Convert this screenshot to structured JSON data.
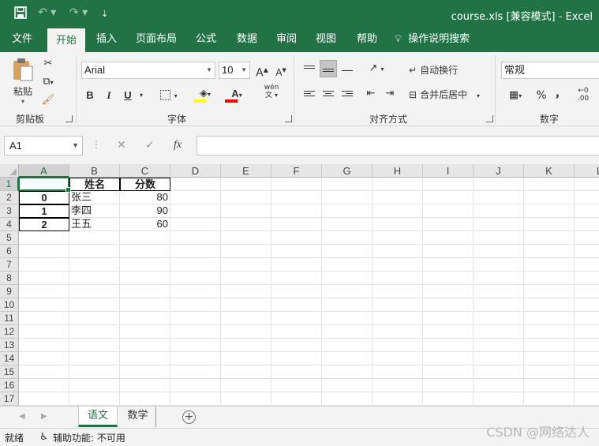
{
  "titlebar": {
    "title": "course.xls  [兼容模式]  -  Excel",
    "save_icon": "save-icon",
    "undo_icon": "undo-icon",
    "redo_icon": "redo-icon",
    "customize_icon": "customize-toolbar-icon"
  },
  "tabs": [
    "文件",
    "开始",
    "插入",
    "页面布局",
    "公式",
    "数据",
    "审阅",
    "视图",
    "帮助"
  ],
  "active_tab": "开始",
  "tell_me": "操作说明搜索",
  "ribbon": {
    "clipboard": {
      "paste": "粘贴",
      "label": "剪贴板"
    },
    "font": {
      "name": "Arial",
      "size": "10",
      "grow": "A",
      "shrink": "A",
      "bold": "B",
      "italic": "I",
      "underline": "U",
      "phonetic": "wén",
      "phonetic_char": "文",
      "label": "字体",
      "highlight_color": "#ffff00",
      "font_color": "#ff0000"
    },
    "alignment": {
      "wrap": "自动换行",
      "merge": "合并后居中",
      "label": "对齐方式"
    },
    "number": {
      "format": "常规",
      "percent": "%",
      "comma": "，",
      "label": "数字"
    }
  },
  "formula_bar": {
    "name_box": "A1",
    "cancel": "✕",
    "enter": "✓",
    "fx": "fx",
    "value": ""
  },
  "sheet": {
    "columns": [
      "A",
      "B",
      "C",
      "D",
      "E",
      "F",
      "G",
      "H",
      "I",
      "J",
      "K",
      "L"
    ],
    "rows": [
      "1",
      "2",
      "3",
      "4",
      "5",
      "6",
      "7",
      "8",
      "9",
      "10",
      "11",
      "12",
      "13",
      "14",
      "15",
      "16",
      "17"
    ],
    "header_row": {
      "A": "",
      "B": "姓名",
      "C": "分数"
    },
    "data": [
      {
        "A": "0",
        "B": "张三",
        "C": "80"
      },
      {
        "A": "1",
        "B": "李四",
        "C": "90"
      },
      {
        "A": "2",
        "B": "王五",
        "C": "60"
      }
    ],
    "active_cell": "A1"
  },
  "sheet_tabs": [
    "语文",
    "数学"
  ],
  "active_sheet": "语文",
  "status": {
    "ready": "就绪",
    "accessibility": "辅助功能: 不可用"
  },
  "watermark": "CSDN @网络达人",
  "colors": {
    "accent": "#217346"
  }
}
